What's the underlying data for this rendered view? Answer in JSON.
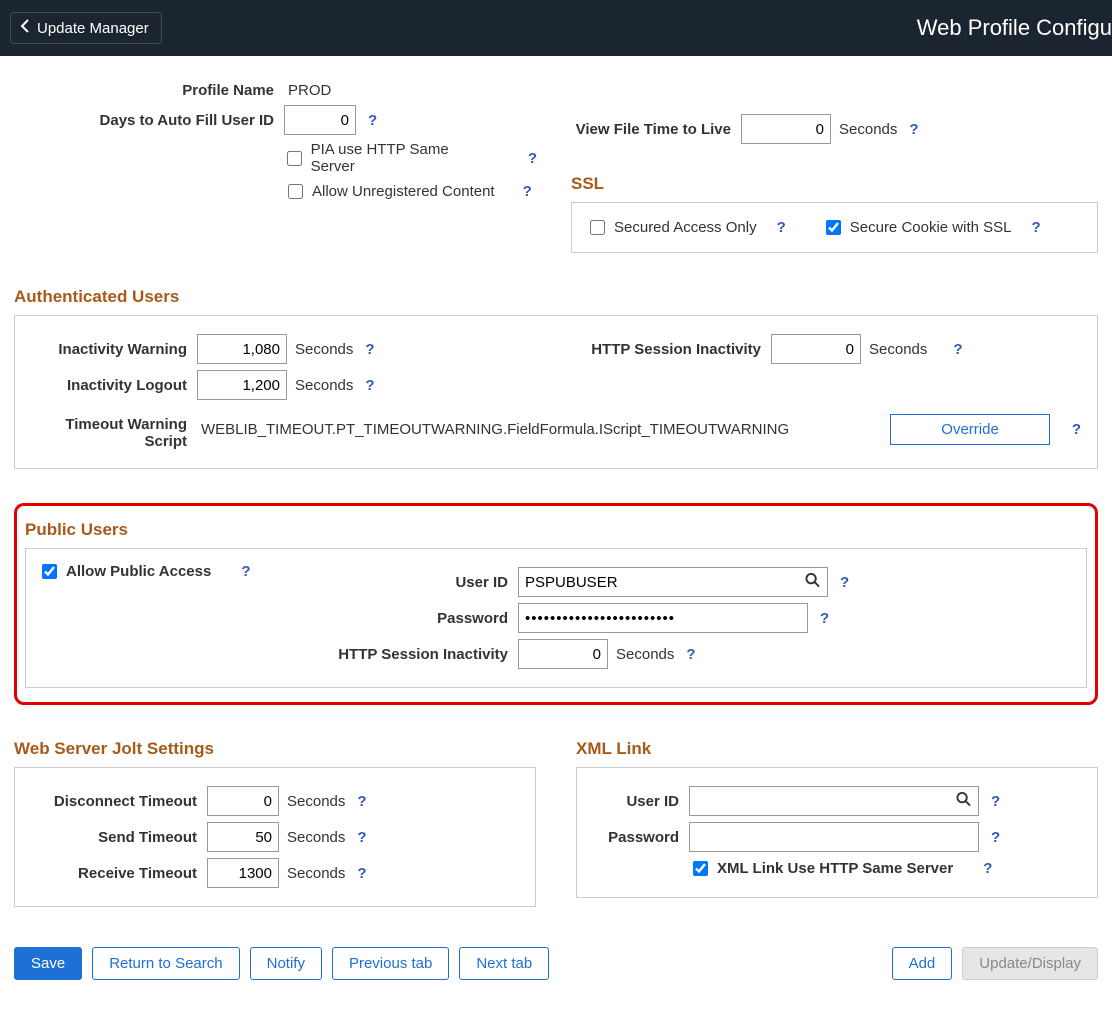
{
  "header": {
    "back_label": "Update Manager",
    "page_title": "Web Profile Configu"
  },
  "profile": {
    "name_label": "Profile Name",
    "name_value": "PROD",
    "days_autofill_label": "Days to Auto Fill User ID",
    "days_autofill_value": "0",
    "pia_same_server_label": "PIA use HTTP Same Server",
    "allow_unreg_label": "Allow Unregistered Content",
    "view_file_ttl_label": "View File Time to Live",
    "view_file_ttl_value": "0",
    "seconds": "Seconds"
  },
  "ssl": {
    "title": "SSL",
    "secured_access_label": "Secured Access Only",
    "secure_cookie_label": "Secure Cookie with SSL"
  },
  "auth": {
    "title": "Authenticated Users",
    "inactivity_warning_label": "Inactivity Warning",
    "inactivity_warning_value": "1,080",
    "inactivity_logout_label": "Inactivity Logout",
    "inactivity_logout_value": "1,200",
    "http_session_label": "HTTP Session Inactivity",
    "http_session_value": "0",
    "timeout_script_label": "Timeout Warning Script",
    "timeout_script_value": "WEBLIB_TIMEOUT.PT_TIMEOUTWARNING.FieldFormula.IScript_TIMEOUTWARNING",
    "override_label": "Override",
    "seconds": "Seconds"
  },
  "public": {
    "title": "Public Users",
    "allow_label": "Allow Public Access",
    "user_id_label": "User ID",
    "user_id_value": "PSPUBUSER",
    "password_label": "Password",
    "password_value": "••••••••••••••••••••••••",
    "http_session_label": "HTTP Session Inactivity",
    "http_session_value": "0",
    "seconds": "Seconds"
  },
  "jolt": {
    "title": "Web Server Jolt Settings",
    "disconnect_label": "Disconnect Timeout",
    "disconnect_value": "0",
    "send_label": "Send Timeout",
    "send_value": "50",
    "receive_label": "Receive Timeout",
    "receive_value": "1300",
    "seconds": "Seconds"
  },
  "xml": {
    "title": "XML Link",
    "user_id_label": "User ID",
    "user_id_value": "",
    "password_label": "Password",
    "password_value": "",
    "same_server_label": "XML Link Use HTTP Same Server"
  },
  "buttons": {
    "save": "Save",
    "return": "Return to Search",
    "notify": "Notify",
    "prev": "Previous tab",
    "next": "Next tab",
    "add": "Add",
    "update": "Update/Display"
  },
  "help": "?"
}
